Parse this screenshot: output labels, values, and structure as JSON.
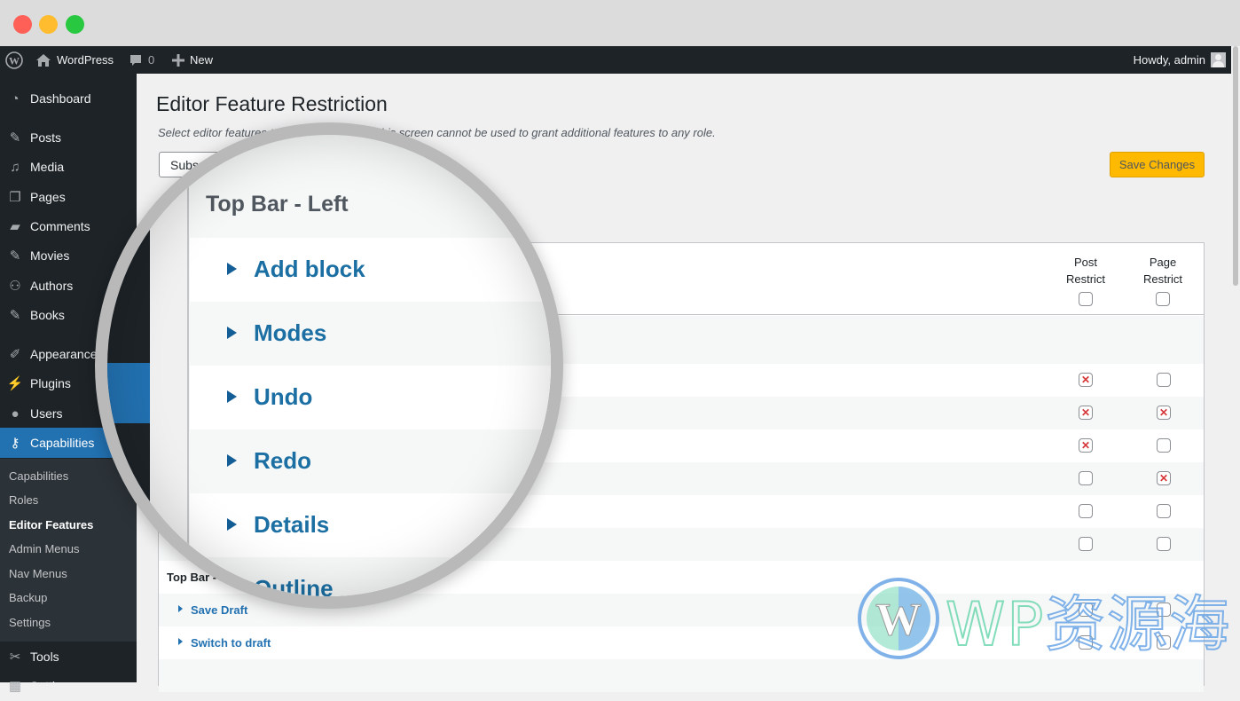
{
  "window": {
    "controls": [
      "close",
      "minimize",
      "maximize"
    ]
  },
  "adminbar": {
    "site_name": "WordPress",
    "comments_count": "0",
    "new_label": "New",
    "howdy": "Howdy, admin"
  },
  "sidebar": {
    "items": [
      {
        "label": "Dashboard",
        "icon": "dashboard-icon"
      },
      {
        "label": "Posts",
        "icon": "pin-icon"
      },
      {
        "label": "Media",
        "icon": "media-icon"
      },
      {
        "label": "Pages",
        "icon": "pages-icon"
      },
      {
        "label": "Comments",
        "icon": "comment-icon"
      },
      {
        "label": "Movies",
        "icon": "pin-icon"
      },
      {
        "label": "Authors",
        "icon": "groups-icon"
      },
      {
        "label": "Books",
        "icon": "pin-icon"
      },
      {
        "label": "Appearance",
        "icon": "brush-icon"
      },
      {
        "label": "Plugins",
        "icon": "plugin-icon"
      },
      {
        "label": "Users",
        "icon": "user-icon"
      },
      {
        "label": "Capabilities",
        "icon": "key-icon",
        "active": true
      },
      {
        "label": "Tools",
        "icon": "wrench-icon"
      },
      {
        "label": "Settings",
        "icon": "settings-icon"
      }
    ],
    "submenu": [
      {
        "label": "Capabilities"
      },
      {
        "label": "Roles"
      },
      {
        "label": "Editor Features",
        "current": true
      },
      {
        "label": "Admin Menus"
      },
      {
        "label": "Nav Menus"
      },
      {
        "label": "Backup"
      },
      {
        "label": "Settings"
      }
    ]
  },
  "main": {
    "title": "Editor Feature Restriction",
    "description": "Select editor features to remove. Note that this screen cannot be used to grant additional features to any role.",
    "role_select_value": "Subscriber",
    "save_label": "Save Changes",
    "columns": {
      "post": "Post Restrict",
      "post_l1": "Post",
      "post_l2": "Restrict",
      "page": "Page Restrict",
      "page_l1": "Page",
      "page_l2": "Restrict"
    },
    "rows": [
      {
        "post": true,
        "page": false
      },
      {
        "post": true,
        "page": true
      },
      {
        "post": true,
        "page": false
      },
      {
        "post": false,
        "page": true
      },
      {
        "post": false,
        "page": false
      },
      {
        "post": false,
        "page": false
      }
    ],
    "section_top_bar_right": "Top Bar - Right",
    "right_items": [
      {
        "label": "Save Draft",
        "post": false,
        "page": false
      },
      {
        "label": "Switch to draft",
        "post": false,
        "page": false
      }
    ]
  },
  "magnifier": {
    "section": "Top Bar - Left",
    "items": [
      "Add block",
      "Modes",
      "Undo",
      "Redo",
      "Details",
      "Outline"
    ]
  },
  "watermark": {
    "brand": "WP",
    "text": "资源海"
  },
  "colors": {
    "admin_dark": "#1d2327",
    "accent_blue": "#2271b1",
    "save_button": "#ffb900",
    "restrict_x": "#d63638"
  }
}
